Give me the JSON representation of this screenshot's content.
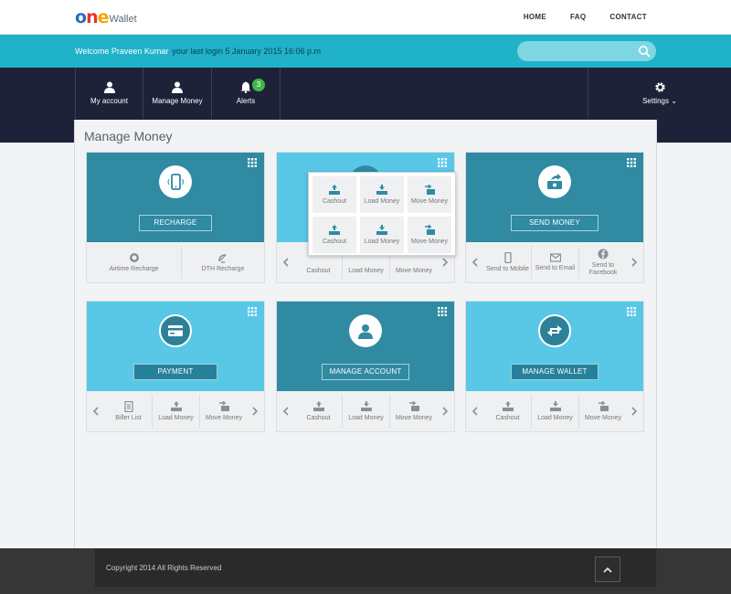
{
  "header": {
    "logo_one": "one",
    "logo_wallet": "Wallet",
    "nav": [
      "HOME",
      "FAQ",
      "CONTACT"
    ]
  },
  "welcome": {
    "greeting": "Welcome Praveen Kumar",
    "last_login": "your last login 5 January 2015 16:06 p.m"
  },
  "search": {
    "placeholder": "",
    "icon": "search-icon"
  },
  "mainnav": {
    "items": [
      {
        "label": "My account",
        "icon": "user-icon"
      },
      {
        "label": "Manage Money",
        "icon": "user-icon"
      },
      {
        "label": "Alerts",
        "icon": "bell-icon",
        "badge": "3"
      }
    ],
    "settings": {
      "label": "Settings",
      "icon": "gear-icon"
    }
  },
  "page": {
    "title": "Manage Money"
  },
  "cards": [
    {
      "button": "RECHARGE",
      "icon": "mobile-icon",
      "actions": [
        {
          "label": "Airtime  Recharge"
        },
        {
          "label": "DTH Recharge"
        }
      ]
    },
    {
      "button": "",
      "icon": "wallet-icon",
      "actions": [
        {
          "label": "Cashout"
        },
        {
          "label": "Load Money"
        },
        {
          "label": "Move Money"
        }
      ]
    },
    {
      "button": "SEND MONEY",
      "icon": "send-money-icon",
      "actions": [
        {
          "label": "Send to Mobile"
        },
        {
          "label": "Send to Email"
        },
        {
          "label": "Send to Facebook"
        }
      ]
    },
    {
      "button": "PAYMENT",
      "icon": "card-icon",
      "actions": [
        {
          "label": "Biller List"
        },
        {
          "label": "Load Money"
        },
        {
          "label": "Move Money"
        }
      ]
    },
    {
      "button": "MANAGE ACCOUNT",
      "icon": "user-icon",
      "actions": [
        {
          "label": "Cashout"
        },
        {
          "label": "Load Money"
        },
        {
          "label": "Move Money"
        }
      ]
    },
    {
      "button": "MANAGE WALLET",
      "icon": "exchange-icon",
      "actions": [
        {
          "label": "Cashout"
        },
        {
          "label": "Load Money"
        },
        {
          "label": "Move Money"
        }
      ]
    }
  ],
  "popup": {
    "items": [
      "Cashout",
      "Load Money",
      "Move Money",
      "Cashout",
      "Load Money",
      "Move Money"
    ]
  },
  "footer": {
    "copyright": "Copyright 2014 All Rights Reserved"
  },
  "colors": {
    "teal": "#1fb2c8",
    "navy": "#1d2238",
    "card_dark": "#2f8aa2",
    "card_light": "#58c8e6"
  }
}
